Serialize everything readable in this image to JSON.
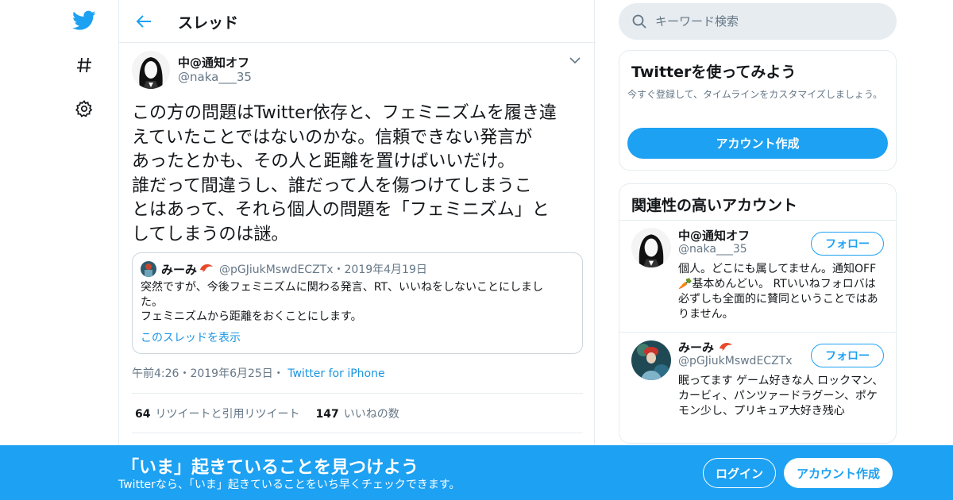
{
  "nav": {
    "icons": [
      "twitter-bird-icon",
      "hashtag-icon",
      "gear-icon"
    ]
  },
  "header": {
    "title": "スレッド"
  },
  "tweet": {
    "author_name": "中@通知オフ",
    "author_handle": "@naka___35",
    "text": "この方の問題はTwitter依存と、フェミニズムを履き違\nえていたことではないのかな。信頼できない発言が\nあったとかも、その人と距離を置けばいいだけ。\n誰だって間違うし、誰だって人を傷つけてしまうこ\nとはあって、それら個人の問題を「フェミニズム」と\nしてしまうのは謎。",
    "quote": {
      "name": "みーみ",
      "handle_date": "@pGJiukMswdECZTx・2019年4月19日",
      "text": "突然ですが、今後フェミニズムに関わる発言、RT、いいねをしないことにしまし\nた。\nフェミニズムから距離をおくことにします。",
      "link": "このスレッドを表示"
    },
    "time": "午前4:26・2019年6月25日・",
    "source": "Twitter for iPhone",
    "retweets_count": "64",
    "retweets_label": "リツイートと引用リツイート",
    "likes_count": "147",
    "likes_label": "いいねの数"
  },
  "search": {
    "placeholder": "キーワード検索"
  },
  "signup_card": {
    "title": "Twitterを使ってみよう",
    "desc": "今すぐ登録して、タイムラインをカスタマイズしましょう。",
    "button": "アカウント作成"
  },
  "related": {
    "title": "関連性の高いアカウント",
    "accounts": [
      {
        "name": "中@通知オフ",
        "handle": "@naka___35",
        "bio": "個人。どこにも属してません。通知OFF🥕基本めんどい。 RTいいねフォロバは必ずしも全面的に賛同ということではありません。",
        "follow": "フォロー"
      },
      {
        "name": "みーみ",
        "handle": "@pGJiukMswdECZTx",
        "bio": "眠ってます ゲーム好きな人 ロックマン、カービィ、パンツァードラグーン、ポケモン少し、プリキュア大好き残心",
        "follow": "フォロー"
      }
    ]
  },
  "banner": {
    "title": "「いま」起きていることを見つけよう",
    "subtitle": "Twitterなら、「いま」起きていることをいち早くチェックできます。",
    "login": "ログイン",
    "signup": "アカウント作成"
  },
  "colors": {
    "accent": "#1da1f2",
    "link": "#1b95e0",
    "secondary_text": "#657786",
    "border": "#e6ecf0"
  }
}
